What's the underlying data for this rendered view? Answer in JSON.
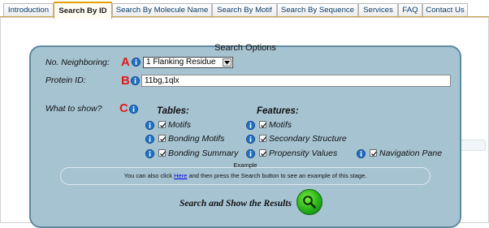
{
  "tabs": [
    {
      "label": "Introduction",
      "active": false
    },
    {
      "label": "Search By ID",
      "active": true
    },
    {
      "label": "Search By Molecule Name",
      "active": false
    },
    {
      "label": "Search By Motif",
      "active": false
    },
    {
      "label": "Search By Sequence",
      "active": false
    },
    {
      "label": "Services",
      "active": false
    },
    {
      "label": "FAQ",
      "active": false
    },
    {
      "label": "Contact Us",
      "active": false
    }
  ],
  "panel": {
    "title": "Search Options",
    "neighboring": {
      "label": "No. Neighboring:",
      "marker": "A",
      "selected": "1 Flanking Residue"
    },
    "protein_id": {
      "label": "Protein ID:",
      "marker": "B",
      "value": "11bg,1qlx"
    },
    "what_to_show": {
      "label": "What to show?",
      "marker": "C",
      "tables_heading": "Tables:",
      "features_heading": "Features:",
      "tables": [
        {
          "label": "Motifs",
          "checked": true
        },
        {
          "label": "Bonding Motifs",
          "checked": true
        },
        {
          "label": "Bonding Summary",
          "checked": true
        }
      ],
      "features": [
        {
          "label": "Motifs",
          "checked": true
        },
        {
          "label": "Secondary Structure",
          "checked": true
        },
        {
          "label": "Propensity Values",
          "checked": true
        }
      ],
      "extra": {
        "label": "Navigation Pane",
        "checked": true
      }
    },
    "example": {
      "title": "Example",
      "text_before": "You can also click ",
      "link": "Here",
      "text_after": " and then press the Search button to see an example of this stage."
    },
    "submit_label": "Search and Show the Results"
  },
  "icons": {
    "info": "info-icon",
    "search": "magnifier-icon"
  },
  "colors": {
    "panel_bg": "#a6c3d2",
    "panel_border": "#5f8aa0",
    "marker": "#e01b1b",
    "search_button": "#26b01a",
    "active_tab_accent": "#e6a100"
  }
}
